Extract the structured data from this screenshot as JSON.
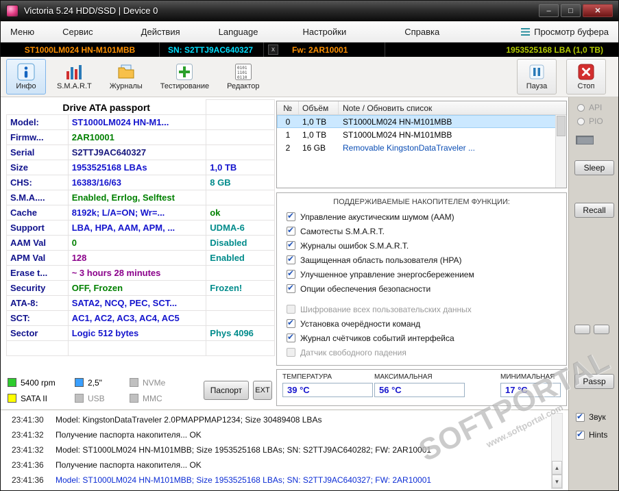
{
  "colors": {
    "value_blue": "#1414cd",
    "value_green": "#008000",
    "value_purple": "#8b008b",
    "value_teal": "#008b8b",
    "label_navy": "#10128c",
    "band_orange": "#ff9000",
    "band_cyan": "#00e0ff",
    "band_yellow_green": "#b4cc00",
    "selection": "#cbe8ff",
    "stop_red": "#d32f2f"
  },
  "icons": {
    "minimize": "–",
    "maximize": "□",
    "close": "✕",
    "band_close": "x",
    "scroll_up": "▲",
    "scroll_down": "▼"
  },
  "window": {
    "title": "Victoria 5.24 HDD/SSD | Device 0"
  },
  "menu": {
    "items": [
      "Меню",
      "Сервис",
      "Действия",
      "Language",
      "Настройки",
      "Справка"
    ],
    "buffer_view": "Просмотр буфера"
  },
  "device_band": {
    "model": "ST1000LM024 HN-M101MBB",
    "serial": "SN: S2TTJ9AC640327",
    "firmware": "Fw: 2AR10001",
    "capacity": "1953525168 LBA (1,0 TB)"
  },
  "toolbar": {
    "info": "Инфо",
    "smart": "S.M.A.R.T",
    "journals": "Журналы",
    "testing": "Тестирование",
    "editor": "Редактор",
    "pause": "Пауза",
    "stop": "Стоп"
  },
  "passport": {
    "title": "Drive ATA passport",
    "rows": [
      {
        "label": "Model:",
        "value": "ST1000LM024 HN-M1...",
        "extra": ""
      },
      {
        "label": "Firmw...",
        "value": "2AR10001",
        "extra": ""
      },
      {
        "label": "Serial",
        "value": "S2TTJ9AC640327",
        "extra": ""
      },
      {
        "label": "Size",
        "value": "1953525168 LBAs",
        "extra": "1,0 TB"
      },
      {
        "label": "CHS:",
        "value": "16383/16/63",
        "extra": "8 GB"
      },
      {
        "label": "S.M.A....",
        "value": "Enabled, Errlog, Selftest",
        "extra": ""
      },
      {
        "label": "Cache",
        "value": "8192k; L/A=ON; Wr=...",
        "extra": "ok"
      },
      {
        "label": "Support",
        "value": "LBA, HPA, AAM, APM, ...",
        "extra": "UDMA-6"
      },
      {
        "label": "AAM Val",
        "value": "0",
        "extra": "Disabled"
      },
      {
        "label": "APM Val",
        "value": "128",
        "extra": "Enabled"
      },
      {
        "label": "Erase t...",
        "value": "~ 3 hours 28 minutes",
        "extra": ""
      },
      {
        "label": "Security",
        "value": "OFF, Frozen",
        "extra": "Frozen!"
      },
      {
        "label": "ATA-8:",
        "value": "SATA2, NCQ, PEC, SCT...",
        "extra": ""
      },
      {
        "label": "SCT:",
        "value": "AC1, AC2, AC3, AC4, AC5",
        "extra": ""
      },
      {
        "label": "Sector",
        "value": "Logic 512 bytes",
        "extra": "Phys 4096"
      }
    ]
  },
  "legend": {
    "rpm": "5400 rpm",
    "form_factor": "2,5\"",
    "nvme": "NVMe",
    "sata": "SATA II",
    "usb": "USB",
    "mmc": "MMC",
    "passport_button": "Паспорт",
    "ext_button": "EXT"
  },
  "device_list": {
    "columns": [
      "№",
      "Объём",
      "Note / Обновить список"
    ],
    "rows": [
      {
        "num": "0",
        "size": "1,0 TB",
        "note": "ST1000LM024 HN-M101MBB"
      },
      {
        "num": "1",
        "size": "1,0 TB",
        "note": "ST1000LM024 HN-M101MBB"
      },
      {
        "num": "2",
        "size": "16 GB",
        "note": "Removable KingstonDataTraveler ..."
      }
    ]
  },
  "features": {
    "title": "ПОДДЕРЖИВАЕМЫЕ НАКОПИТЕЛЕМ ФУНКЦИИ:",
    "items": [
      "Управление акустическим шумом (AAM)",
      "Самотесты S.M.A.R.T.",
      "Журналы ошибок S.M.A.R.T.",
      "Защищенная область пользователя (HPA)",
      "Улучшенное управление энергосбережением",
      "Опции обеспечения безопасности",
      "Шифрование всех пользовательских данных",
      "Установка очерёдности команд",
      "Журнал счётчиков событий интерфейса",
      "Датчик свободного падения"
    ]
  },
  "temperature": {
    "current_label": "ТЕМПЕРАТУРА",
    "current": "39 °C",
    "max_label": "МАКСИМАЛЬНАЯ",
    "max": "56 °C",
    "min_label": "МИНИМАЛЬНАЯ",
    "min": "17 °C"
  },
  "sidebar": {
    "api": "API",
    "pio": "PIO",
    "sleep": "Sleep",
    "recall": "Recall",
    "passp": "Passp",
    "sound": "Звук",
    "hints": "Hints"
  },
  "log": {
    "lines": [
      {
        "time": "23:41:30",
        "text": "Model: KingstonDataTraveler 2.0PMAPPMAP1234; Size 30489408 LBAs"
      },
      {
        "time": "23:41:32",
        "text": "Получение паспорта накопителя... OK"
      },
      {
        "time": "23:41:32",
        "text": "Model: ST1000LM024 HN-M101MBB; Size 1953525168 LBAs; SN: S2TTJ9AC640282; FW: 2AR10001"
      },
      {
        "time": "23:41:36",
        "text": "Получение паспорта накопителя... OK"
      },
      {
        "time": "23:41:36",
        "text": "Model: ST1000LM024 HN-M101MBB; Size 1953525168 LBAs; SN: S2TTJ9AC640327; FW: 2AR10001"
      }
    ]
  },
  "watermark": {
    "title": "SOFTPORTAL",
    "url": "www.softportal.com"
  }
}
